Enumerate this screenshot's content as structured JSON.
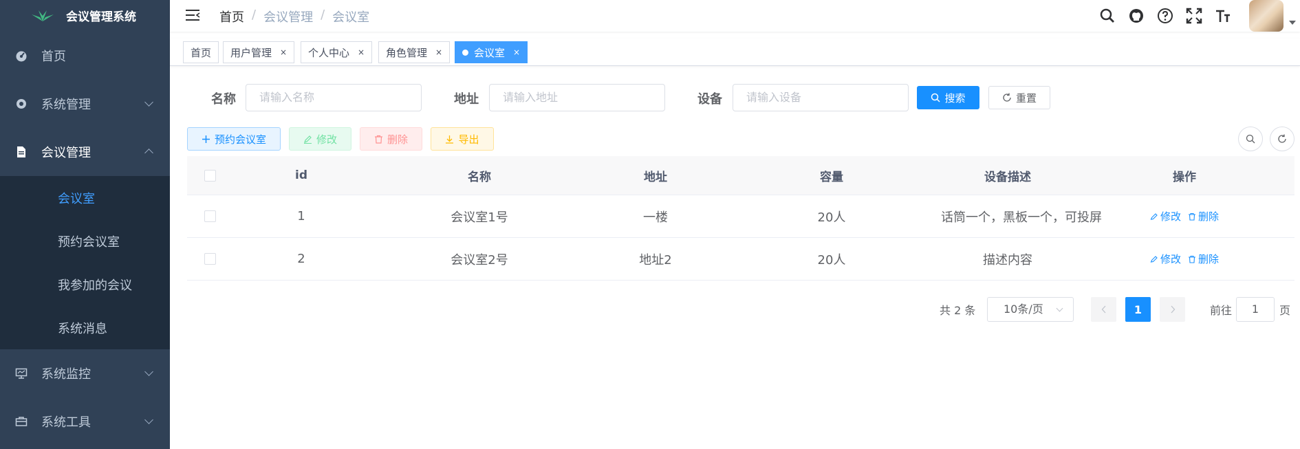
{
  "app": {
    "title": "会议管理系统"
  },
  "sidebar": {
    "items": [
      {
        "label": "首页",
        "icon": "dashboard-icon"
      },
      {
        "label": "系统管理",
        "icon": "gear-icon"
      },
      {
        "label": "会议管理",
        "icon": "document-icon"
      },
      {
        "label": "系统监控",
        "icon": "monitor-icon"
      },
      {
        "label": "系统工具",
        "icon": "toolbox-icon"
      }
    ],
    "submenu": [
      {
        "label": "会议室",
        "active": true
      },
      {
        "label": "预约会议室"
      },
      {
        "label": "我参加的会议"
      },
      {
        "label": "系统消息"
      }
    ]
  },
  "breadcrumb": {
    "home": "首页",
    "sep": "/",
    "parent": "会议管理",
    "current": "会议室"
  },
  "tags": [
    {
      "label": "首页"
    },
    {
      "label": "用户管理",
      "close": "×"
    },
    {
      "label": "个人中心",
      "close": "×"
    },
    {
      "label": "角色管理",
      "close": "×"
    },
    {
      "label": "会议室",
      "close": "×",
      "active": true
    }
  ],
  "search": {
    "name_label": "名称",
    "name_placeholder": "请输入名称",
    "addr_label": "地址",
    "addr_placeholder": "请输入地址",
    "device_label": "设备",
    "device_placeholder": "请输入设备",
    "search_btn": "搜索",
    "reset_btn": "重置"
  },
  "toolbar": {
    "add": "预约会议室",
    "edit": "修改",
    "delete": "删除",
    "export": "导出"
  },
  "table": {
    "headers": {
      "id": "id",
      "name": "名称",
      "addr": "地址",
      "cap": "容量",
      "desc": "设备描述",
      "ops": "操作"
    },
    "rows": [
      {
        "id": "1",
        "name": "会议室1号",
        "addr": "一楼",
        "cap": "20人",
        "desc": "话筒一个，黑板一个，可投屏"
      },
      {
        "id": "2",
        "name": "会议室2号",
        "addr": "地址2",
        "cap": "20人",
        "desc": "描述内容"
      }
    ],
    "op_edit": "修改",
    "op_delete": "删除"
  },
  "pagination": {
    "total": "共 2 条",
    "page_size": "10条/页",
    "current_page": "1",
    "goto_label": "前往",
    "goto_value": "1",
    "page_suffix": "页"
  },
  "colors": {
    "sidebar_bg": "#304156",
    "submenu_bg": "#1f2d3d",
    "primary": "#1890ff",
    "active_tag": "#409eff"
  }
}
